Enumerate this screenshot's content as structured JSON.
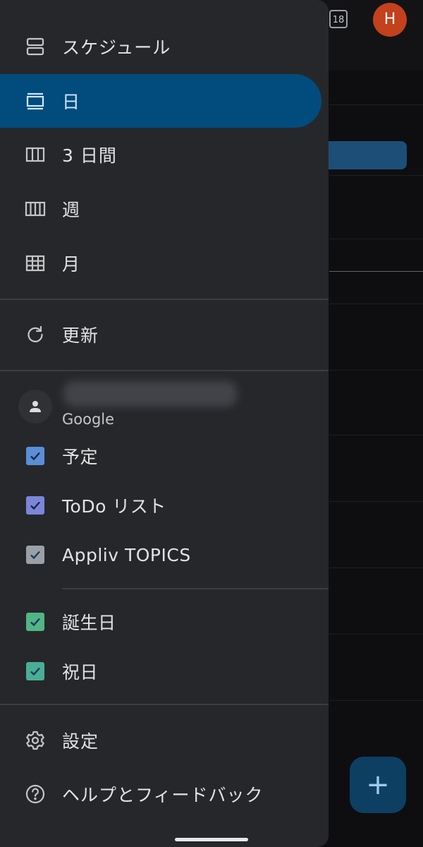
{
  "background": {
    "today_date": "18",
    "avatar_initial": "H",
    "fab_symbol": "+"
  },
  "drawer": {
    "views": [
      {
        "label": "スケジュール",
        "icon": "schedule-view-icon",
        "active": false
      },
      {
        "label": "日",
        "icon": "day-view-icon",
        "active": true
      },
      {
        "label": "3 日間",
        "icon": "three-day-view-icon",
        "active": false
      },
      {
        "label": "週",
        "icon": "week-view-icon",
        "active": false
      },
      {
        "label": "月",
        "icon": "month-view-icon",
        "active": false
      }
    ],
    "refresh_label": "更新",
    "account": {
      "provider": "Google"
    },
    "calendars": [
      {
        "label": "予定",
        "color": "#5a8ed6",
        "checked": true
      },
      {
        "label": "ToDo リスト",
        "color": "#7b86d9",
        "checked": true
      },
      {
        "label": "Appliv TOPICS",
        "color": "#9aa0a6",
        "checked": true
      }
    ],
    "other_calendars": [
      {
        "label": "誕生日",
        "color": "#52b583",
        "checked": true
      },
      {
        "label": "祝日",
        "color": "#4aae94",
        "checked": true
      }
    ],
    "settings_label": "設定",
    "help_label": "ヘルプとフィードバック"
  },
  "colors": {
    "drawer_bg": "#26272b",
    "active_item_bg": "#014c7d",
    "avatar_bg": "#c3411c"
  }
}
